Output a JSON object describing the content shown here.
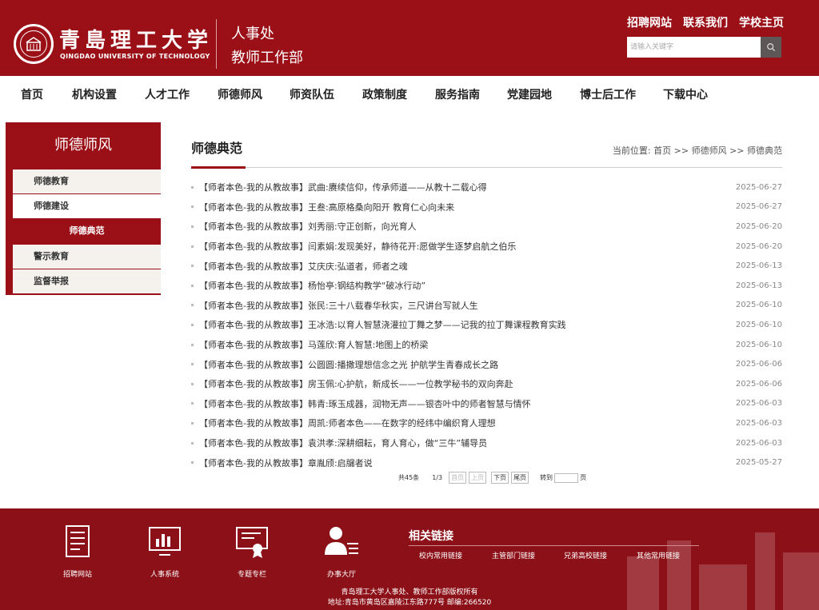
{
  "header": {
    "university_name": "青島理工大学",
    "university_name_en": "QINGDAO UNIVERSITY OF TECHNOLOGY",
    "dept_line1": "人事处",
    "dept_line2": "教师工作部",
    "top_links": [
      "招聘网站",
      "联系我们",
      "学校主页"
    ],
    "search_placeholder": "请输入关键字",
    "brand_color": "#9b0f17"
  },
  "nav": {
    "items": [
      "首页",
      "机构设置",
      "人才工作",
      "师德师风",
      "师资队伍",
      "政策制度",
      "服务指南",
      "党建园地",
      "博士后工作",
      "下载中心"
    ]
  },
  "sidebar": {
    "title": "师德师风",
    "items": [
      "师德教育",
      "师德建设",
      "师德典范",
      "警示教育",
      "监督举报"
    ],
    "active": "师德典范"
  },
  "content": {
    "title": "师德典范",
    "breadcrumb_label": "当前位置:",
    "breadcrumb": "首页 >> 师德师风 >> 师德典范",
    "news": [
      {
        "title": "【师者本色-我的从教故事】武曲:赓续信仰，传承师道——从教十二载心得",
        "date": "2025-06-27"
      },
      {
        "title": "【师者本色-我的从教故事】王叁:高原格桑向阳开 教育仁心向未来",
        "date": "2025-06-27"
      },
      {
        "title": "【师者本色-我的从教故事】刘秀丽:守正创新，向光育人",
        "date": "2025-06-20"
      },
      {
        "title": "【师者本色-我的从教故事】闫素娟:发现美好，静待花开:愿做学生逐梦启航之伯乐",
        "date": "2025-06-20"
      },
      {
        "title": "【师者本色-我的从教故事】艾庆庆:弘道者，师者之魂",
        "date": "2025-06-13"
      },
      {
        "title": "【师者本色-我的从教故事】杨怡亭:钢结构教学“破冰行动”",
        "date": "2025-06-13"
      },
      {
        "title": "【师者本色-我的从教故事】张民:三十八载春华秋实，三尺讲台写就人生",
        "date": "2025-06-10"
      },
      {
        "title": "【师者本色-我的从教故事】王冰浩:以育人智慧浇灌拉丁舞之梦——记我的拉丁舞课程教育实践",
        "date": "2025-06-10"
      },
      {
        "title": "【师者本色-我的从教故事】马莲欣:育人智慧:地图上的桥梁",
        "date": "2025-06-10"
      },
      {
        "title": "【师者本色-我的从教故事】公圆圆:播撒理想信念之光 护航学生青春成长之路",
        "date": "2025-06-06"
      },
      {
        "title": "【师者本色-我的从教故事】房玉佩:心护航，新成长——一位教学秘书的双向奔赴",
        "date": "2025-06-06"
      },
      {
        "title": "【师者本色-我的从教故事】韩青:琢玉成器，润物无声——银杏叶中的师者智慧与情怀",
        "date": "2025-06-03"
      },
      {
        "title": "【师者本色-我的从教故事】周凯:师者本色——在数字的经纬中编织育人理想",
        "date": "2025-06-03"
      },
      {
        "title": "【师者本色-我的从教故事】袁洪孝:深耕细耘，育人育心，做“三牛”辅导员",
        "date": "2025-06-03"
      },
      {
        "title": "【师者本色-我的从教故事】章胤颀:启牖者说",
        "date": "2025-05-27"
      }
    ],
    "pager": {
      "total": "共45条",
      "page": "1/3",
      "first": "首页",
      "prev": "上页",
      "next": "下页",
      "last": "尾页",
      "jump": "转到",
      "page_unit": "页"
    }
  },
  "footer": {
    "quick": [
      {
        "label": "招聘网站",
        "icon": "document-icon"
      },
      {
        "label": "人事系统",
        "icon": "chart-monitor-icon"
      },
      {
        "label": "专题专栏",
        "icon": "certificate-icon"
      },
      {
        "label": "办事大厅",
        "icon": "person-list-icon"
      }
    ],
    "related_title": "相关链接",
    "related_links": [
      "校内常用链接",
      "主管部门链接",
      "兄弟高校链接",
      "其他常用链接"
    ],
    "copyright": "青岛理工大学人事处、教师工作部版权所有",
    "address": "地址:青岛市黄岛区嘉陵江东路777号 邮编:266520"
  }
}
